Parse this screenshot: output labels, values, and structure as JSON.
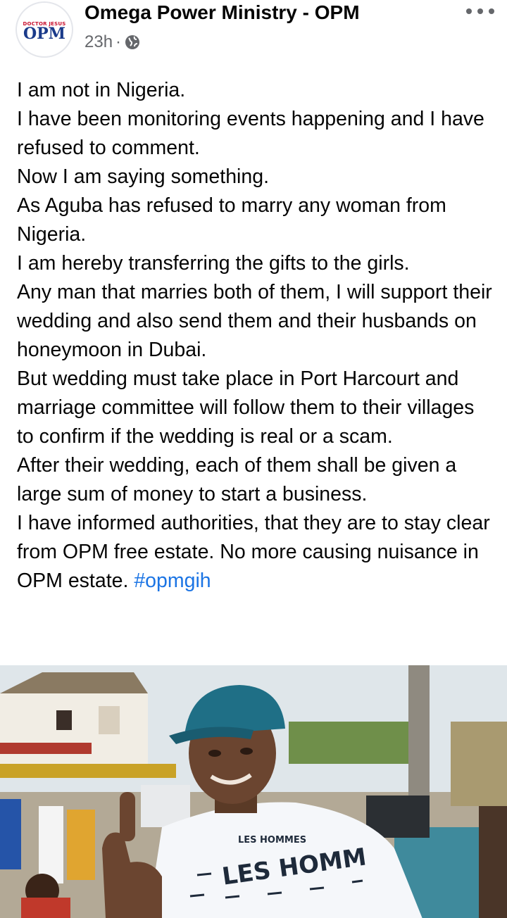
{
  "post": {
    "page_name": "Omega Power Ministry - OPM",
    "timestamp": "23h",
    "separator": "·",
    "audience_icon": "globe-icon",
    "more_icon": "more-options-icon",
    "avatar": {
      "top_text": "DOCTOR JESUS",
      "logo_text": "OPM"
    },
    "body_lines": [
      "I am not in Nigeria.",
      "I have been monitoring events happening and I have refused to comment.",
      "Now I am saying something.",
      "As Aguba has refused to marry any woman from Nigeria.",
      "I am hereby transferring the gifts to the girls.",
      "Any man that marries both of them, I will support their wedding and also send them and their husbands on honeymoon in Dubai.",
      "But wedding must take place in Port Harcourt and marriage committee will follow them to their villages to confirm if the wedding is real or a scam.",
      "After their wedding, each of them shall be given a large sum of money to start a business.",
      "I have informed authorities, that they are to stay clear from OPM free estate. No more causing nuisance in OPM estate."
    ],
    "hashtag": "#opmgih",
    "photo": {
      "shirt_small": "LES HOMMES",
      "shirt_large": "LES HOMM"
    }
  },
  "colors": {
    "text": "#050505",
    "meta": "#65676b",
    "link": "#1b74e4",
    "background": "#ffffff"
  }
}
